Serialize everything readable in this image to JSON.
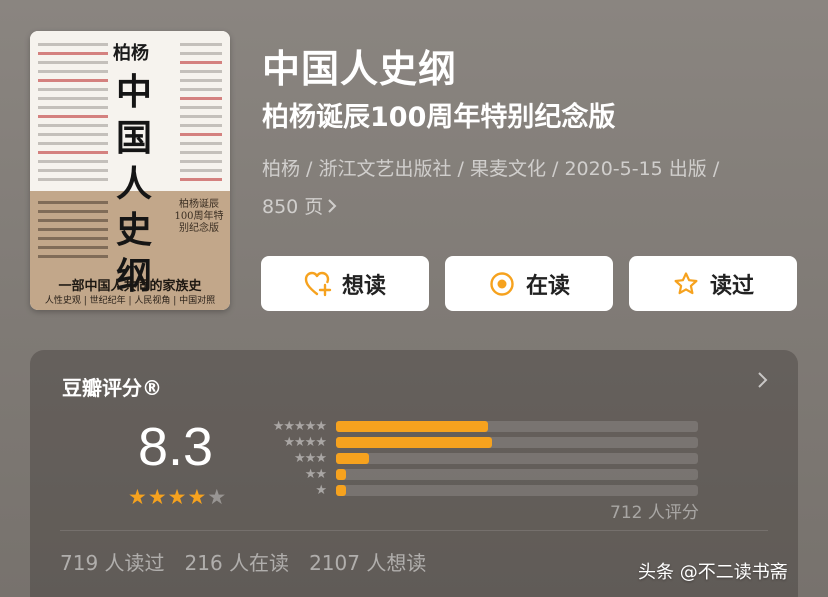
{
  "book": {
    "title": "中国人史纲",
    "subtitle": "柏杨诞辰100周年特别纪念版",
    "meta_line": "柏杨 / 浙江文艺出版社 / 果麦文化 / 2020-5-15 出版 /",
    "pages": "850 页",
    "cover": {
      "author": "柏杨",
      "title_chars": [
        "中",
        "国",
        "人",
        "史",
        "纲"
      ],
      "edition": "柏杨诞辰100周年特别纪念版",
      "slogan": "一部中国人共同的家族史",
      "subslogan": "人性史观 | 世纪纪年 | 人民视角 | 中国对照"
    }
  },
  "actions": {
    "want": {
      "label": "想读",
      "icon": "heart-plus-icon"
    },
    "reading": {
      "label": "在读",
      "icon": "target-circle-icon"
    },
    "read": {
      "label": "读过",
      "icon": "star-outline-icon"
    }
  },
  "rating": {
    "header": "豆瓣评分®",
    "score": "8.3",
    "stars_filled": 4,
    "stars_total": 5,
    "distribution": [
      {
        "stars": 5,
        "fraction": 0.42
      },
      {
        "stars": 4,
        "fraction": 0.43
      },
      {
        "stars": 3,
        "fraction": 0.09
      },
      {
        "stars": 2,
        "fraction": 0.02
      },
      {
        "stars": 1,
        "fraction": 0.02
      }
    ],
    "raters": "712 人评分",
    "counts": {
      "read": "719 人读过",
      "reading": "216 人在读",
      "want": "2107 人想读"
    }
  },
  "watermark": "头条 @不二读书斋",
  "colors": {
    "accent": "#f6a21e",
    "background": "#847f7a",
    "button_bg": "#ffffff"
  }
}
